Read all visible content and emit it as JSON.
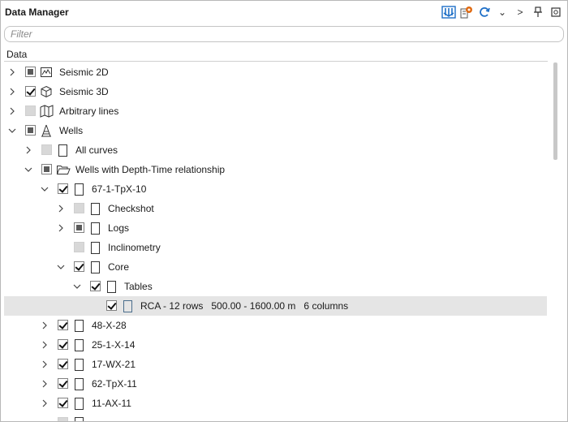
{
  "window": {
    "title": "Data Manager"
  },
  "toolbar": {
    "buttons": [
      {
        "name": "well-import-icon"
      },
      {
        "name": "settings-gear-icon"
      },
      {
        "name": "refresh-icon"
      },
      {
        "name": "chevron-down-icon"
      },
      {
        "name": "chevron-right-icon"
      },
      {
        "name": "pin-icon"
      },
      {
        "name": "maximize-icon"
      }
    ]
  },
  "filter": {
    "placeholder": "Filter",
    "value": ""
  },
  "column_header": "Data",
  "tree": [
    {
      "label": "Seismic 2D",
      "level": 0,
      "expander": "collapsed",
      "check": "partial",
      "icon": "seismic-2d-icon"
    },
    {
      "label": "Seismic 3D",
      "level": 0,
      "expander": "collapsed",
      "check": "checked",
      "icon": "seismic-3d-cube-icon"
    },
    {
      "label": "Arbitrary lines",
      "level": 0,
      "expander": "collapsed",
      "check": "unchecked",
      "icon": "arbitrary-lines-icon"
    },
    {
      "label": "Wells",
      "level": 0,
      "expander": "expanded",
      "check": "partial",
      "icon": "well-derrick-icon"
    },
    {
      "label": "All curves",
      "level": 1,
      "expander": "collapsed",
      "check": "unchecked",
      "icon": "document-icon"
    },
    {
      "label": "Wells with Depth-Time relationship",
      "level": 1,
      "expander": "expanded",
      "check": "partial",
      "icon": "folder-open-icon"
    },
    {
      "label": "67-1-TpX-10",
      "level": 2,
      "expander": "expanded",
      "check": "checked",
      "icon": "document-icon"
    },
    {
      "label": "Checkshot",
      "level": 3,
      "expander": "collapsed",
      "check": "unchecked",
      "icon": "document-icon"
    },
    {
      "label": "Logs",
      "level": 3,
      "expander": "collapsed",
      "check": "partial",
      "icon": "document-icon"
    },
    {
      "label": "Inclinometry",
      "level": 3,
      "expander": "none",
      "check": "unchecked",
      "icon": "document-icon"
    },
    {
      "label": "Core",
      "level": 3,
      "expander": "expanded",
      "check": "checked",
      "icon": "document-icon"
    },
    {
      "label": "Tables",
      "level": 4,
      "expander": "expanded",
      "check": "checked",
      "icon": "document-icon"
    },
    {
      "label": "RCA - 12 rows   500.00 - 1600.00 m   6 columns",
      "level": 5,
      "expander": "none",
      "check": "checked",
      "icon": "table-document-icon",
      "selected": true
    },
    {
      "label": "48-X-28",
      "level": 2,
      "expander": "collapsed",
      "check": "checked",
      "icon": "document-icon"
    },
    {
      "label": "25-1-X-14",
      "level": 2,
      "expander": "collapsed",
      "check": "checked",
      "icon": "document-icon"
    },
    {
      "label": "17-WX-21",
      "level": 2,
      "expander": "collapsed",
      "check": "checked",
      "icon": "document-icon"
    },
    {
      "label": "62-TpX-11",
      "level": 2,
      "expander": "collapsed",
      "check": "checked",
      "icon": "document-icon"
    },
    {
      "label": "11-AX-11",
      "level": 2,
      "expander": "collapsed",
      "check": "checked",
      "icon": "document-icon"
    },
    {
      "label": "",
      "level": 2,
      "expander": "none",
      "check": "unchecked",
      "icon": "document-icon"
    }
  ],
  "colors": {
    "selected_row": "#e5e5e5",
    "accent_blue": "#1e6fc7",
    "accent_orange": "#e06a12"
  }
}
